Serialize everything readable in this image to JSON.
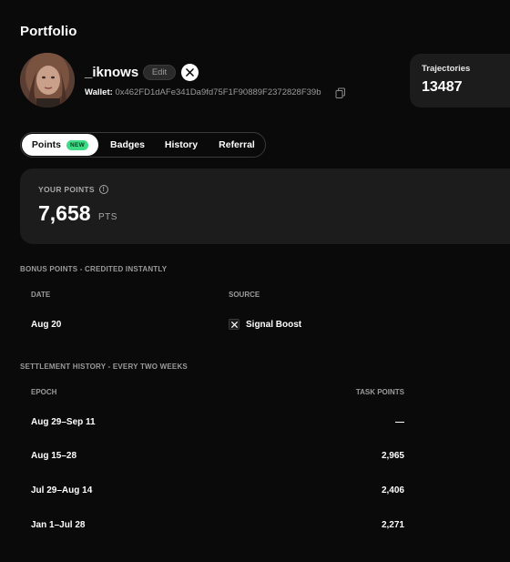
{
  "page": {
    "title": "Portfolio"
  },
  "profile": {
    "username": "_iknows",
    "edit_label": "Edit",
    "wallet_label": "Wallet:",
    "wallet_address": "0x462FD1dAFe341Da9fd75F1F90889F2372828F39b"
  },
  "trajectories": {
    "label": "Trajectories",
    "value": "13487"
  },
  "tabs": [
    {
      "label": "Points",
      "badge": "NEW",
      "active": true
    },
    {
      "label": "Badges"
    },
    {
      "label": "History"
    },
    {
      "label": "Referral"
    }
  ],
  "points": {
    "label": "YOUR POINTS",
    "value": "7,658",
    "unit": "PTS"
  },
  "bonus": {
    "title": "BONUS POINTS - CREDITED INSTANTLY",
    "columns": [
      "DATE",
      "SOURCE"
    ],
    "rows": [
      {
        "date": "Aug 20",
        "source": "Signal Boost"
      }
    ]
  },
  "settlement": {
    "title": "SETTLEMENT HISTORY - EVERY TWO WEEKS",
    "columns": [
      "EPOCH",
      "TASK POINTS"
    ],
    "rows": [
      {
        "epoch": "Aug 29–Sep 11",
        "points": "—"
      },
      {
        "epoch": "Aug 15–28",
        "points": "2,965"
      },
      {
        "epoch": "Jul 29–Aug 14",
        "points": "2,406"
      },
      {
        "epoch": "Jan 1–Jul 28",
        "points": "2,271"
      }
    ]
  },
  "colors": {
    "background": "#0a0a0a",
    "card": "#1c1c1c",
    "badge_green": "#3ddc84"
  },
  "icons": [
    "x-logo-icon",
    "copy-icon",
    "info-icon"
  ]
}
